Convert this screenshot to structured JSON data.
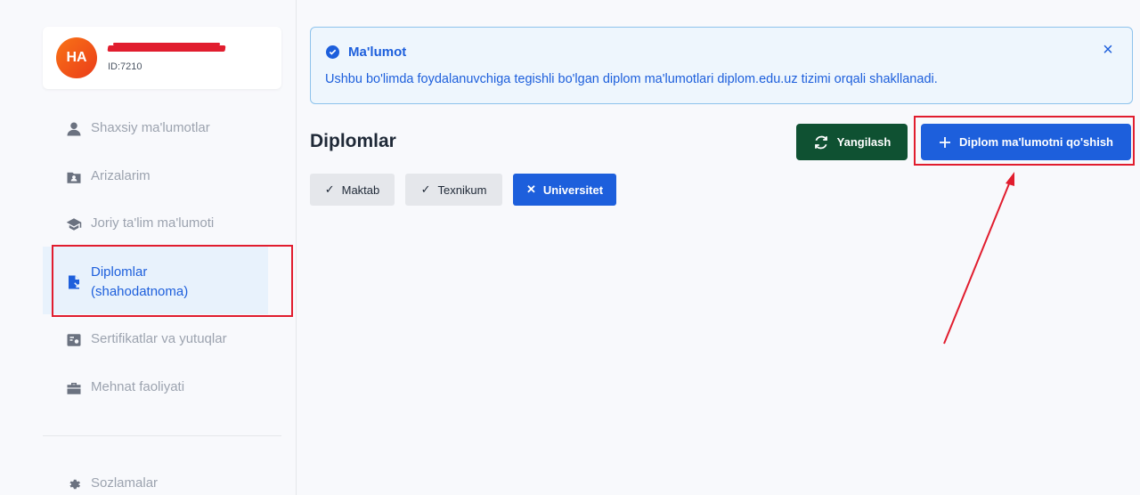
{
  "profile": {
    "initials": "HA",
    "name": "████████████",
    "id_label": "ID:7210"
  },
  "sidebar": {
    "items": [
      {
        "label": "Shaxsiy ma'lumotlar",
        "icon": "user-icon"
      },
      {
        "label": "Arizalarim",
        "icon": "folder-contact-icon"
      },
      {
        "label": "Joriy ta'lim ma'lumoti",
        "icon": "graduation-cap-icon"
      },
      {
        "label": "Diplomlar",
        "label2": "(shahodatnoma)",
        "icon": "document-icon",
        "active": true
      },
      {
        "label": "Sertifikatlar va yutuqlar",
        "icon": "certificate-icon"
      },
      {
        "label": "Mehnat faoliyati",
        "icon": "briefcase-icon"
      }
    ],
    "settings_label": "Sozlamalar"
  },
  "info": {
    "title": "Ma'lumot",
    "text": "Ushbu bo'limda foydalanuvchiga tegishli bo'lgan diplom ma'lumotlari diplom.edu.uz tizimi orqali shakllanadi.",
    "close": "×"
  },
  "main": {
    "title": "Diplomlar",
    "refresh_label": "Yangilash",
    "add_label": "Diplom ma'lumotni qo'shish",
    "chips": [
      {
        "label": "Maktab",
        "mark": "✓"
      },
      {
        "label": "Texnikum",
        "mark": "✓"
      },
      {
        "label": "Universitet",
        "mark": "✕"
      }
    ]
  },
  "colors": {
    "accent": "#1d5fdc",
    "refresh_button": "#0f5132",
    "highlight": "#e11d2e",
    "info_bg": "#eef6fd"
  }
}
